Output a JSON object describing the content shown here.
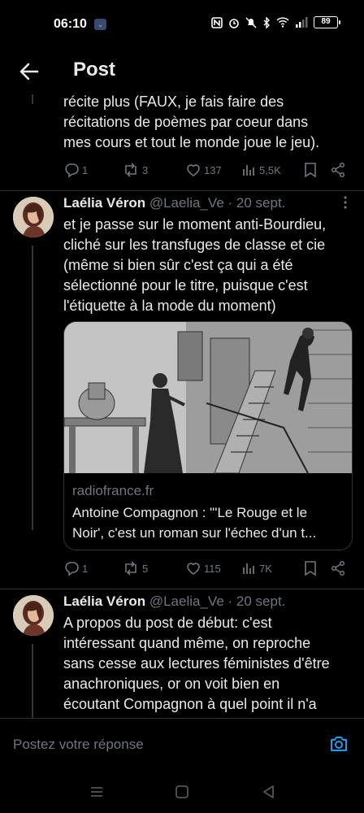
{
  "status_bar": {
    "time": "06:10",
    "battery": "89",
    "icons": [
      "nfc-icon",
      "alarm-icon",
      "mute-icon",
      "bluetooth-icon",
      "wifi-icon",
      "signal-icon"
    ]
  },
  "header": {
    "title": "Post",
    "back_icon": "arrow-left-icon"
  },
  "posts": [
    {
      "text_lines": [
        "récite plus (FAUX, je fais faire des",
        "récitations de poèmes par coeur dans",
        "mes cours et tout le monde joue le jeu)."
      ],
      "replies": "1",
      "reposts": "3",
      "likes": "137",
      "views": "5,5K"
    },
    {
      "author": "Laélia Véron",
      "handle": "@Laelia_Ve",
      "date": "· 20 sept.",
      "text_lines": [
        "et je passe sur le moment anti-Bourdieu,",
        "cliché sur les transfuges de classe et cie",
        "(même si bien sûr c'est ça qui a été",
        "sélectionné pour le titre, puisque c'est",
        "l'étiquette à la mode du moment)"
      ],
      "card": {
        "domain": "radiofrance.fr",
        "title_lines": [
          "Antoine Compagnon : \"'Le Rouge et le",
          "Noir', c'est un roman sur l'échec d'un t..."
        ]
      },
      "replies": "1",
      "reposts": "5",
      "likes": "115",
      "views": "7K"
    },
    {
      "author": "Laélia Véron",
      "handle": "@Laelia_Ve",
      "date": "· 20 sept.",
      "text_lines": [
        "A propos du post de début: c'est",
        "intéressant quand même, on reproche",
        "sans cesse aux lectures féministes d'être",
        "anachroniques, or on voit bien en",
        "écoutant Compagnon à quel point il n'a"
      ]
    }
  ],
  "reply_bar": {
    "placeholder": "Postez votre réponse",
    "camera_icon": "camera-icon"
  },
  "colors": {
    "background": "#000000",
    "text": "#e7e9ea",
    "muted": "#71767b",
    "accent": "#1d9bf0",
    "divider": "#2f3336"
  }
}
